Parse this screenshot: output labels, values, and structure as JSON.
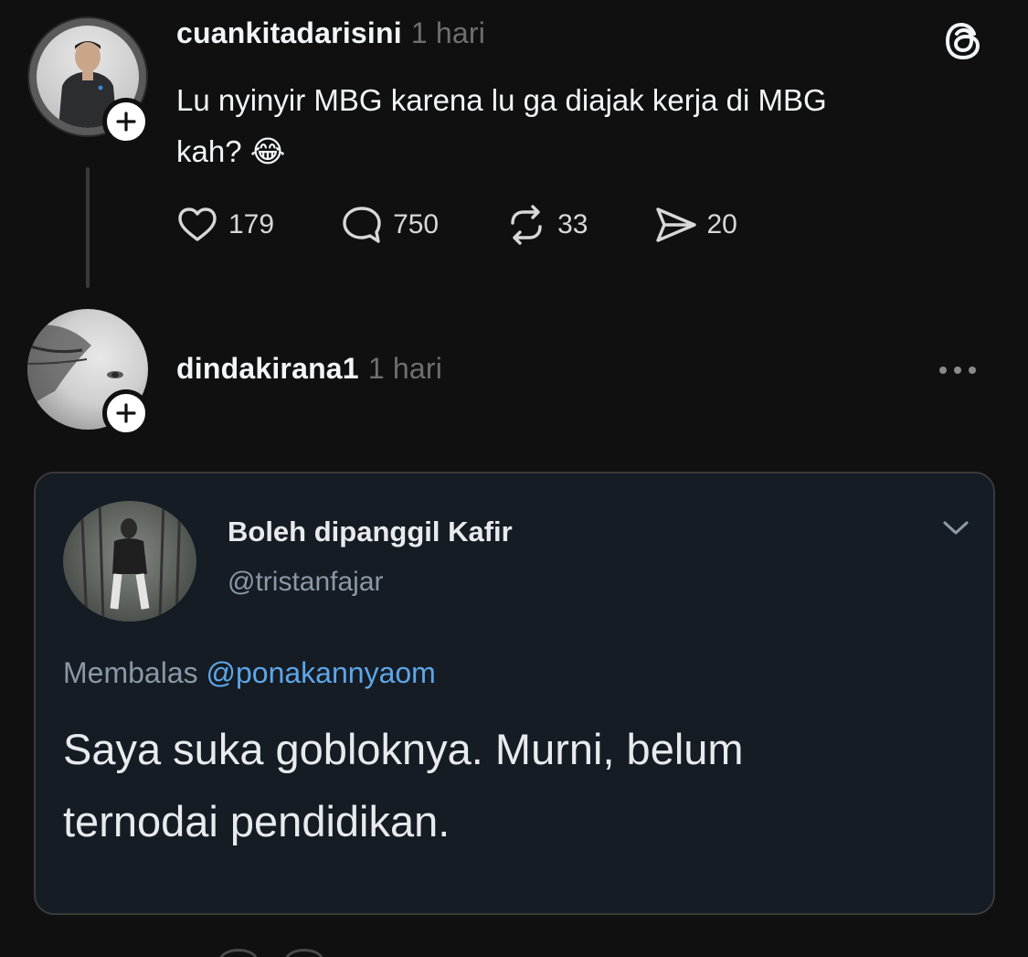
{
  "post": {
    "username": "cuankitadarisini",
    "time": "1 hari",
    "text_line1": "Lu nyinyir MBG karena lu ga diajak kerja di MBG",
    "text_line2": "kah? 😂",
    "likes": "179",
    "replies": "750",
    "reposts": "33",
    "shares": "20",
    "icons": {
      "like": "heart-icon",
      "reply": "comment-icon",
      "repost": "repost-icon",
      "share": "send-icon",
      "logo": "threads-logo-icon",
      "follow": "plus-icon"
    }
  },
  "reply": {
    "username": "dindakirana1",
    "time": "1 hari",
    "embed": {
      "name": "Boleh dipanggil Kafir",
      "handle": "@tristanfajar",
      "reply_prefix": "Membalas",
      "reply_to": "@ponakannyaom",
      "text_line1": "Saya suka gobloknya. Murni, belum",
      "text_line2": "ternodai pendidikan."
    }
  },
  "colors": {
    "background": "#101010",
    "text": "#f3f5f7",
    "muted": "#6f6f6f",
    "embed_bg": "#151c24",
    "mention": "#5ea6e8"
  }
}
